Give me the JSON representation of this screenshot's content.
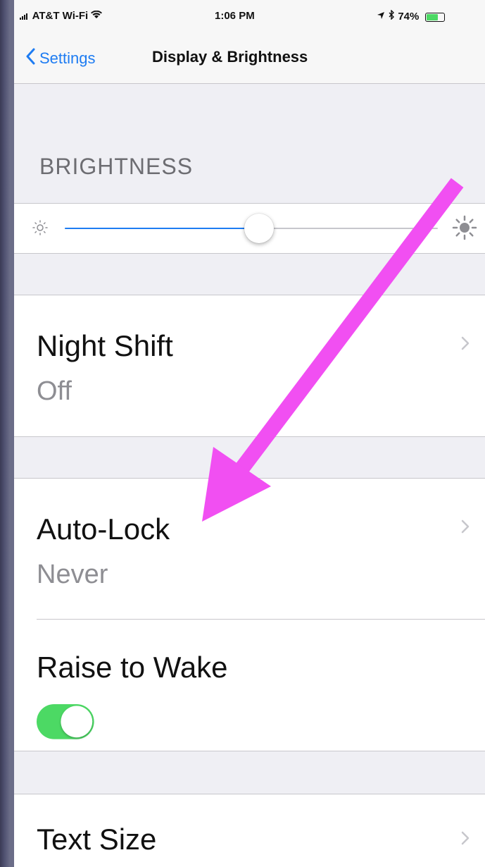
{
  "status_bar": {
    "carrier": "AT&T Wi-Fi",
    "time": "1:06 PM",
    "battery_text": "74%",
    "battery_level": 0.74
  },
  "nav": {
    "back_label": "Settings",
    "title": "Display & Brightness"
  },
  "brightness": {
    "header": "BRIGHTNESS",
    "level": 0.52
  },
  "night_shift": {
    "title": "Night Shift",
    "value": "Off"
  },
  "auto_lock": {
    "title": "Auto-Lock",
    "value": "Never"
  },
  "raise_to_wake": {
    "title": "Raise to Wake",
    "enabled": true
  },
  "text_size": {
    "title": "Text Size"
  },
  "colors": {
    "accent": "#1e7cf2",
    "toggle_on": "#4cd964",
    "annotation_arrow": "#f14ff2"
  },
  "icons": {
    "back": "chevron-left-icon",
    "disclosure": "chevron-right-icon",
    "brightness_low": "sun-small-icon",
    "brightness_high": "sun-large-icon"
  }
}
